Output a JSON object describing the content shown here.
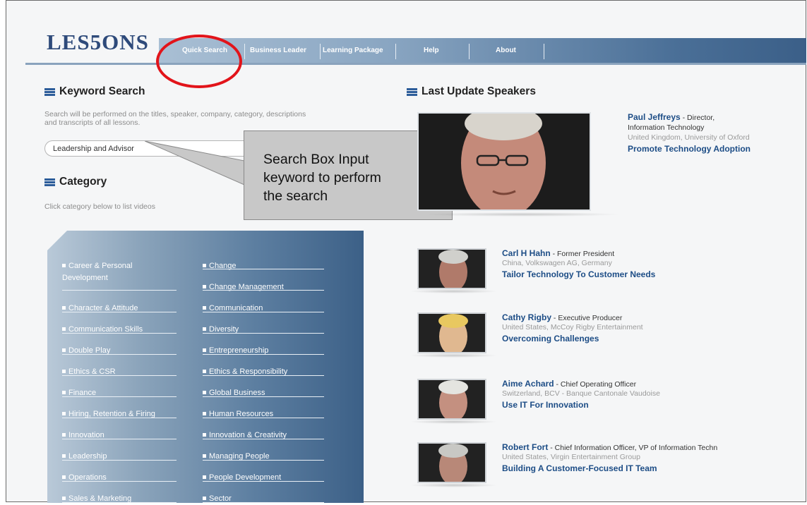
{
  "header": {
    "logo": "LES5ONS",
    "nav": [
      "Quick Search",
      "Business Leader",
      "Learning Package",
      "Help",
      "About"
    ]
  },
  "keyword_search": {
    "title": "Keyword Search",
    "description_1": "Search will be performed on the titles, speaker, company, category, descriptions",
    "description_2": "and transcripts of all lessons.",
    "input_value": "Leadership and Advisor"
  },
  "callout": {
    "text": "Search Box Input\nkeyword to perform\nthe search"
  },
  "category": {
    "title": "Category",
    "description": "Click category below to list videos",
    "left": [
      "Career & Personal Development",
      "Character & Attitude",
      "Communication Skills",
      "Double Play",
      "Ethics & CSR",
      "Finance",
      "Hiring, Retention & Firing",
      "Innovation",
      "Leadership",
      "Operations",
      "Sales & Marketing"
    ],
    "right": [
      "Change",
      "Change Management",
      "Communication",
      "Diversity",
      "Entrepreneurship",
      "Ethics & Responsibility",
      "Global Business",
      "Human Resources",
      "Innovation & Creativity",
      "Managing People",
      "People Development",
      "Sector"
    ]
  },
  "speakers": {
    "title": "Last Update Speakers",
    "featured": {
      "name": "Paul Jeffreys",
      "role": " - Director,",
      "role_line2": "Information Technology",
      "location": "United Kingdom, University of Oxford",
      "lesson": "Promote Technology Adoption"
    },
    "list": [
      {
        "name": "Carl H Hahn",
        "role": " - Former President",
        "location": "China, Volkswagen AG, Germany",
        "lesson": "Tailor Technology To Customer Needs"
      },
      {
        "name": "Cathy Rigby",
        "role": " - Executive Producer",
        "location": "United States, McCoy Rigby Entertainment",
        "lesson": "Overcoming Challenges"
      },
      {
        "name": "Aime Achard",
        "role": " - Chief Operating Officer",
        "location": "Switzerland, BCV - Banque Cantonale Vaudoise",
        "lesson": "Use IT For Innovation"
      },
      {
        "name": "Robert Fort",
        "role": " - Chief Information Officer, VP of Information Techn",
        "location": "United States, Virgin Entertainment Group",
        "lesson": "Building A Customer-Focused IT Team"
      }
    ]
  },
  "colors": {
    "accent": "#1d4d86",
    "highlight": "#e2141a",
    "nav": "#4a6f97"
  }
}
